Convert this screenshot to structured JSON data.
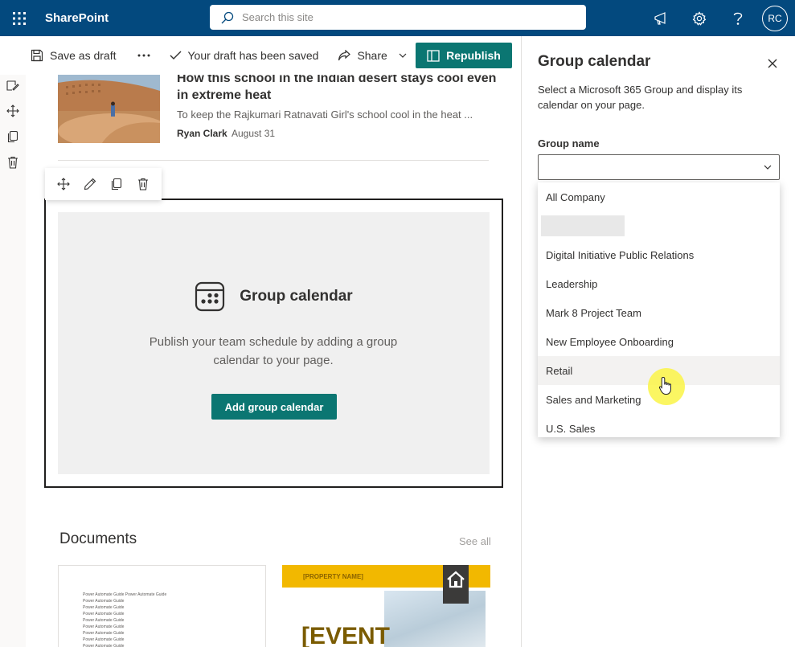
{
  "suite": {
    "app_name": "SharePoint",
    "search_placeholder": "Search this site",
    "avatar_initials": "RC"
  },
  "command_bar": {
    "save_draft": "Save as draft",
    "draft_status": "Your draft has been saved",
    "share": "Share",
    "republish": "Republish"
  },
  "news": {
    "title": "How this school in the Indian desert stays cool even in extreme heat",
    "description": "To keep the Rajkumari Ratnavati Girl's school cool in the heat ...",
    "author": "Ryan Clark",
    "date": "August 31"
  },
  "webpart": {
    "title": "Group calendar",
    "description": "Publish your team schedule by adding a group calendar to your page.",
    "button": "Add group calendar"
  },
  "documents": {
    "title": "Documents",
    "see_all": "See all",
    "doc1_lines": [
      "Power Automate Guide Power Automate Guide",
      "Power Automate Guide",
      "Power Automate Guide",
      "Power Automate Guide",
      "Power Automate Guide",
      "Power Automate Guide",
      "Power Automate Guide",
      "Power Automate Guide",
      "Power Automate Guide"
    ],
    "doc2_property": "[PROPERTY NAME]",
    "doc2_event": "[EVENT"
  },
  "pane": {
    "title": "Group calendar",
    "description": "Select a Microsoft 365 Group and display its calendar on your page.",
    "field_label": "Group name",
    "options": [
      "All Company",
      "",
      "Digital Initiative Public Relations",
      "Leadership",
      "Mark 8 Project Team",
      "New Employee Onboarding",
      "Retail",
      "Sales and Marketing",
      "U.S. Sales"
    ]
  },
  "colors": {
    "suite_bar": "#03497e",
    "accent": "#0b7672",
    "cursor_highlight": "#faf546"
  }
}
